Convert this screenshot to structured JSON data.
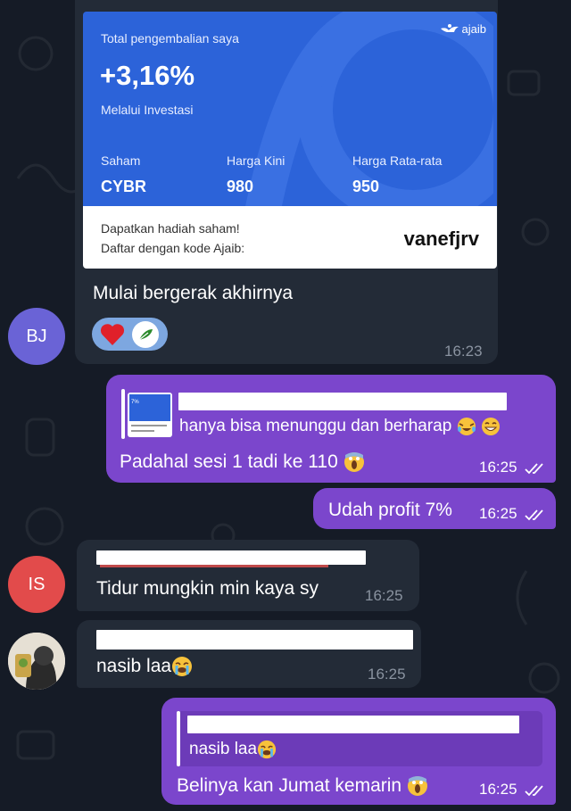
{
  "card": {
    "title": "Total pengembalian saya",
    "brand": "ajaib",
    "return_pct": "+3,16%",
    "subtitle": "Melalui Investasi",
    "col1_label": "Saham",
    "col1_value": "CYBR",
    "col2_label": "Harga Kini",
    "col2_value": "980",
    "col3_label": "Harga Rata-rata",
    "col3_value": "950",
    "promo_line1": "Dapatkan hadiah saham!",
    "promo_line2": "Daftar dengan kode Ajaib:",
    "promo_code": "vanefjrv"
  },
  "messages": [
    {
      "sender_initials": "BJ",
      "text": "Mulai bergerak akhirnya",
      "time": "16:23",
      "avatar_color": "#6a63d6"
    },
    {
      "quote_text": "hanya bisa menunggu dan berharap",
      "thumb_text": "7%",
      "text": "Padahal sesi 1 tadi ke 110",
      "time": "16:25"
    },
    {
      "text": "Udah profit 7%",
      "time": "16:25"
    },
    {
      "sender_initials": "IS",
      "text": "Tidur mungkin min kaya sy",
      "time": "16:25",
      "avatar_color": "#e24b4b"
    },
    {
      "text": "nasib laa",
      "time": "16:25"
    },
    {
      "quote_text": "nasib laa",
      "text": "Belinya kan Jumat kemarin",
      "time": "16:25"
    }
  ],
  "colors": {
    "background": "#151b26",
    "incoming": "#232b37",
    "outgoing": "#7b46cc",
    "card_blue": "#2c63d9"
  }
}
